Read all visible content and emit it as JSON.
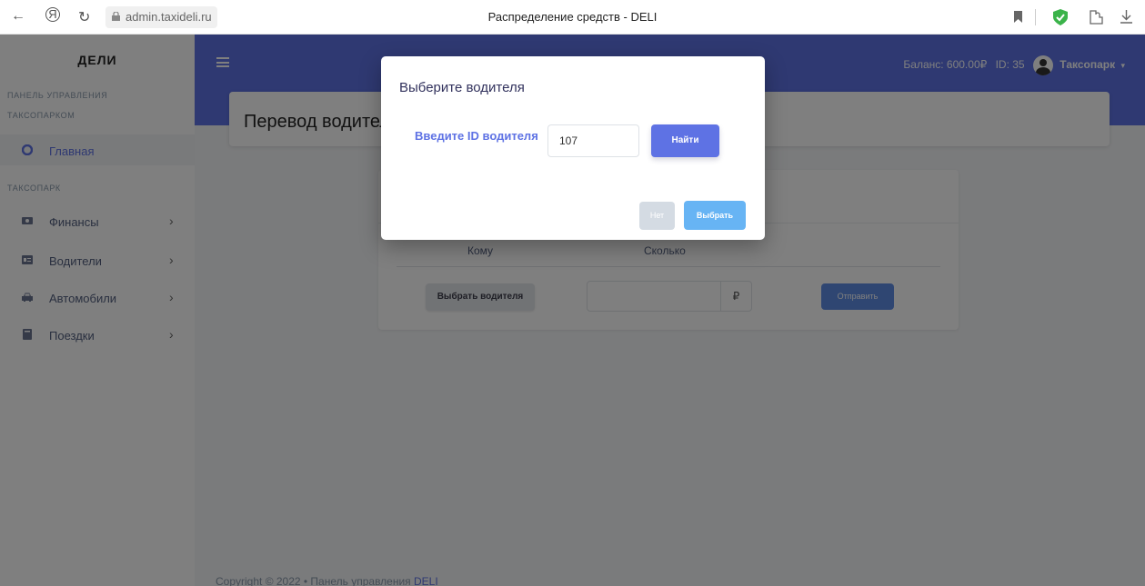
{
  "browser": {
    "back": "←",
    "yandex": "Я",
    "reload": "↻",
    "url": "admin.taxideli.ru",
    "tab_title": "Распределение средств - DELI"
  },
  "sidebar": {
    "brand": "ДЕЛИ",
    "section_admin": "ПАНЕЛЬ УПРАВЛЕНИЯ",
    "section_admin_2": "ТАКСОПАРКОМ",
    "home_label": "Главная",
    "section_park": "ТАКСОПАРК",
    "items": [
      {
        "label": "Финансы",
        "icon": "wallet-icon"
      },
      {
        "label": "Водители",
        "icon": "id-card-icon"
      },
      {
        "label": "Автомобили",
        "icon": "car-icon"
      },
      {
        "label": "Поездки",
        "icon": "book-icon"
      }
    ],
    "chevron": "›"
  },
  "topbar": {
    "balance": "Баланс: 600.00₽",
    "id": "ID: 35",
    "user": "Таксопарк",
    "caret": "▾"
  },
  "page": {
    "heading": "Перевод водителю",
    "col_to": "Кому",
    "col_amount": "Сколько",
    "select_driver": "Выбрать водителя",
    "currency": "₽",
    "send": "Отправить"
  },
  "footer": {
    "text": "Copyright © 2022 • Панель управления ",
    "link": "DELI"
  },
  "modal": {
    "title": "Выберите водителя",
    "label": "Введите ID водителя",
    "input_value": "107",
    "find": "Найти",
    "no": "Нет",
    "choose": "Выбрать"
  },
  "colors": {
    "primary": "#5e72e4",
    "info": "#67b4f4",
    "overlay": "rgba(0,0,0,0.5)"
  }
}
